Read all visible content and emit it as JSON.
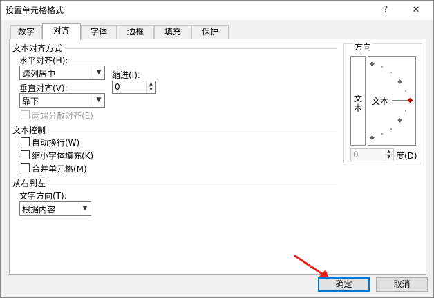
{
  "dialog": {
    "title": "设置单元格格式",
    "help_label": "?",
    "close_label": "✕"
  },
  "tabs": [
    {
      "label": "数字"
    },
    {
      "label": "对齐"
    },
    {
      "label": "字体"
    },
    {
      "label": "边框"
    },
    {
      "label": "填充"
    },
    {
      "label": "保护"
    }
  ],
  "active_tab": "对齐",
  "text_alignment": {
    "group_title": "文本对齐方式",
    "horizontal_label": "水平对齐(H):",
    "horizontal_value": "跨列居中",
    "vertical_label": "垂直对齐(V):",
    "vertical_value": "靠下",
    "indent_label": "缩进(I):",
    "indent_value": "0",
    "justify_distributed_label": "两端分散对齐(E)"
  },
  "text_control": {
    "group_title": "文本控制",
    "wrap_text_label": "自动换行(W)",
    "shrink_to_fit_label": "缩小字体填充(K)",
    "merge_cells_label": "合并单元格(M)"
  },
  "rtl": {
    "group_title": "从右到左",
    "direction_label": "文字方向(T):",
    "direction_value": "根据内容"
  },
  "orientation": {
    "group_title": "方向",
    "vertical_text": "文本",
    "dial_text": "文本",
    "degrees_value": "0",
    "degrees_label": "度(D)"
  },
  "footer": {
    "ok_label": "确定",
    "cancel_label": "取消"
  }
}
